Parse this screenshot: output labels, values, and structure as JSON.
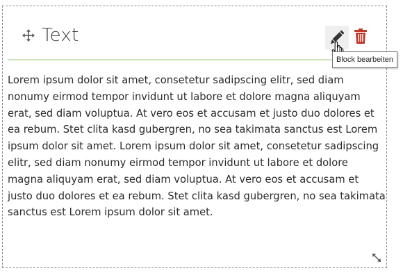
{
  "block": {
    "title": "Text",
    "body": "Lorem ipsum dolor sit amet, consetetur sadipscing elitr, sed diam nonumy eirmod tempor invidunt ut labore et dolore magna aliquyam erat, sed diam voluptua. At vero eos et accusam et justo duo dolores et ea rebum. Stet clita kasd gubergren, no sea takimata sanctus est Lorem ipsum dolor sit amet. Lorem ipsum dolor sit amet, consetetur sadipscing elitr, sed diam nonumy eirmod tempor invidunt ut labore et dolore magna aliquyam erat, sed diam voluptua. At vero eos et accusam et justo duo dolores et ea rebum. Stet clita kasd gubergren, no sea takimata sanctus est Lorem ipsum dolor sit amet."
  },
  "toolbar": {
    "edit_tooltip": "Block bearbeiten",
    "edit_icon": "pencil-icon",
    "delete_icon": "trash-icon",
    "move_icon": "move-icon",
    "resize_icon": "resize-icon"
  },
  "colors": {
    "divider": "#cfe3b8",
    "delete": "#c0392b",
    "edit_bg": "#efefef"
  }
}
